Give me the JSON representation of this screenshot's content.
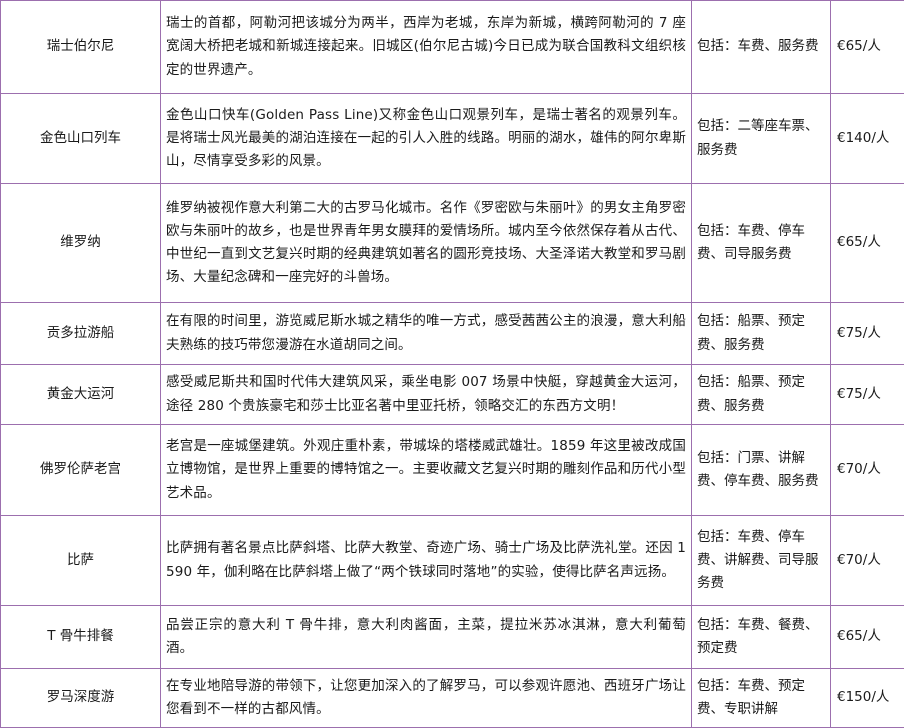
{
  "rows": [
    {
      "name": "瑞士伯尔尼",
      "description": "瑞士的首都，阿勒河把该城分为两半，西岸为老城，东岸为新城，横跨阿勒河的 7 座宽阔大桥把老城和新城连接起来。旧城区(伯尔尼古城)今日已成为联合国教科文组织核定的世界遗产。",
      "includes": "包括：车费、服务费",
      "price": "€65/人"
    },
    {
      "name": "金色山口列车",
      "description": "金色山口快车(Golden Pass Line)又称金色山口观景列车，是瑞士著名的观景列车。是将瑞士风光最美的湖泊连接在一起的引人入胜的线路。明丽的湖水，雄伟的阿尔卑斯山，尽情享受多彩的风景。",
      "includes": "包括：二等座车票、服务费",
      "price": "€140/人"
    },
    {
      "name": "维罗纳",
      "description": "维罗纳被视作意大利第二大的古罗马化城市。名作《罗密欧与朱丽叶》的男女主角罗密欧与朱丽叶的故乡，也是世界青年男女膜拜的爱情场所。城内至今依然保存着从古代、中世纪一直到文艺复兴时期的经典建筑如著名的圆形竞技场、大圣泽诺大教堂和罗马剧场、大量纪念碑和一座完好的斗兽场。",
      "includes": "包括：车费、停车费、司导服务费",
      "price": "€65/人"
    },
    {
      "name": "贡多拉游船",
      "description": "在有限的时间里，游览威尼斯水城之精华的唯一方式，感受茜茜公主的浪漫，意大利船夫熟练的技巧带您漫游在水道胡同之间。",
      "includes": "包括：船票、预定费、服务费",
      "price": "€75/人"
    },
    {
      "name": "黄金大运河",
      "description": "感受威尼斯共和国时代伟大建筑风采，乘坐电影 007 场景中快艇，穿越黄金大运河，途径 280 个贵族豪宅和莎士比亚名著中里亚托桥，领略交汇的东西方文明！",
      "includes": "包括：船票、预定费、服务费",
      "price": "€75/人"
    },
    {
      "name": "佛罗伦萨老宫",
      "description": "老宫是一座城堡建筑。外观庄重朴素，带城垛的塔楼威武雄壮。1859 年这里被改成国立博物馆，是世界上重要的博特馆之一。主要收藏文艺复兴时期的雕刻作品和历代小型艺术品。",
      "includes": "包括：门票、讲解费、停车费、服务费",
      "price": "€70/人"
    },
    {
      "name": "比萨",
      "description": "比萨拥有著名景点比萨斜塔、比萨大教堂、奇迹广场、骑士广场及比萨洗礼堂。还因 1590 年，伽利略在比萨斜塔上做了“两个铁球同时落地”的实验，使得比萨名声远扬。",
      "includes": "包括：车费、停车费、讲解费、司导服务费",
      "price": "€70/人"
    },
    {
      "name": "T 骨牛排餐",
      "description": "品尝正宗的意大利 T 骨牛排，意大利肉酱面，主菜，提拉米苏冰淇淋，意大利葡萄酒。",
      "includes": "包括：车费、餐费、预定费",
      "price": "€65/人"
    },
    {
      "name": "罗马深度游",
      "description": "在专业地陪导游的带领下，让您更加深入的了解罗马，可以参观许愿池、西班牙广场让您看到不一样的古都风情。",
      "includes": "包括：车费、预定费、专职讲解",
      "price": "€150/人"
    }
  ]
}
